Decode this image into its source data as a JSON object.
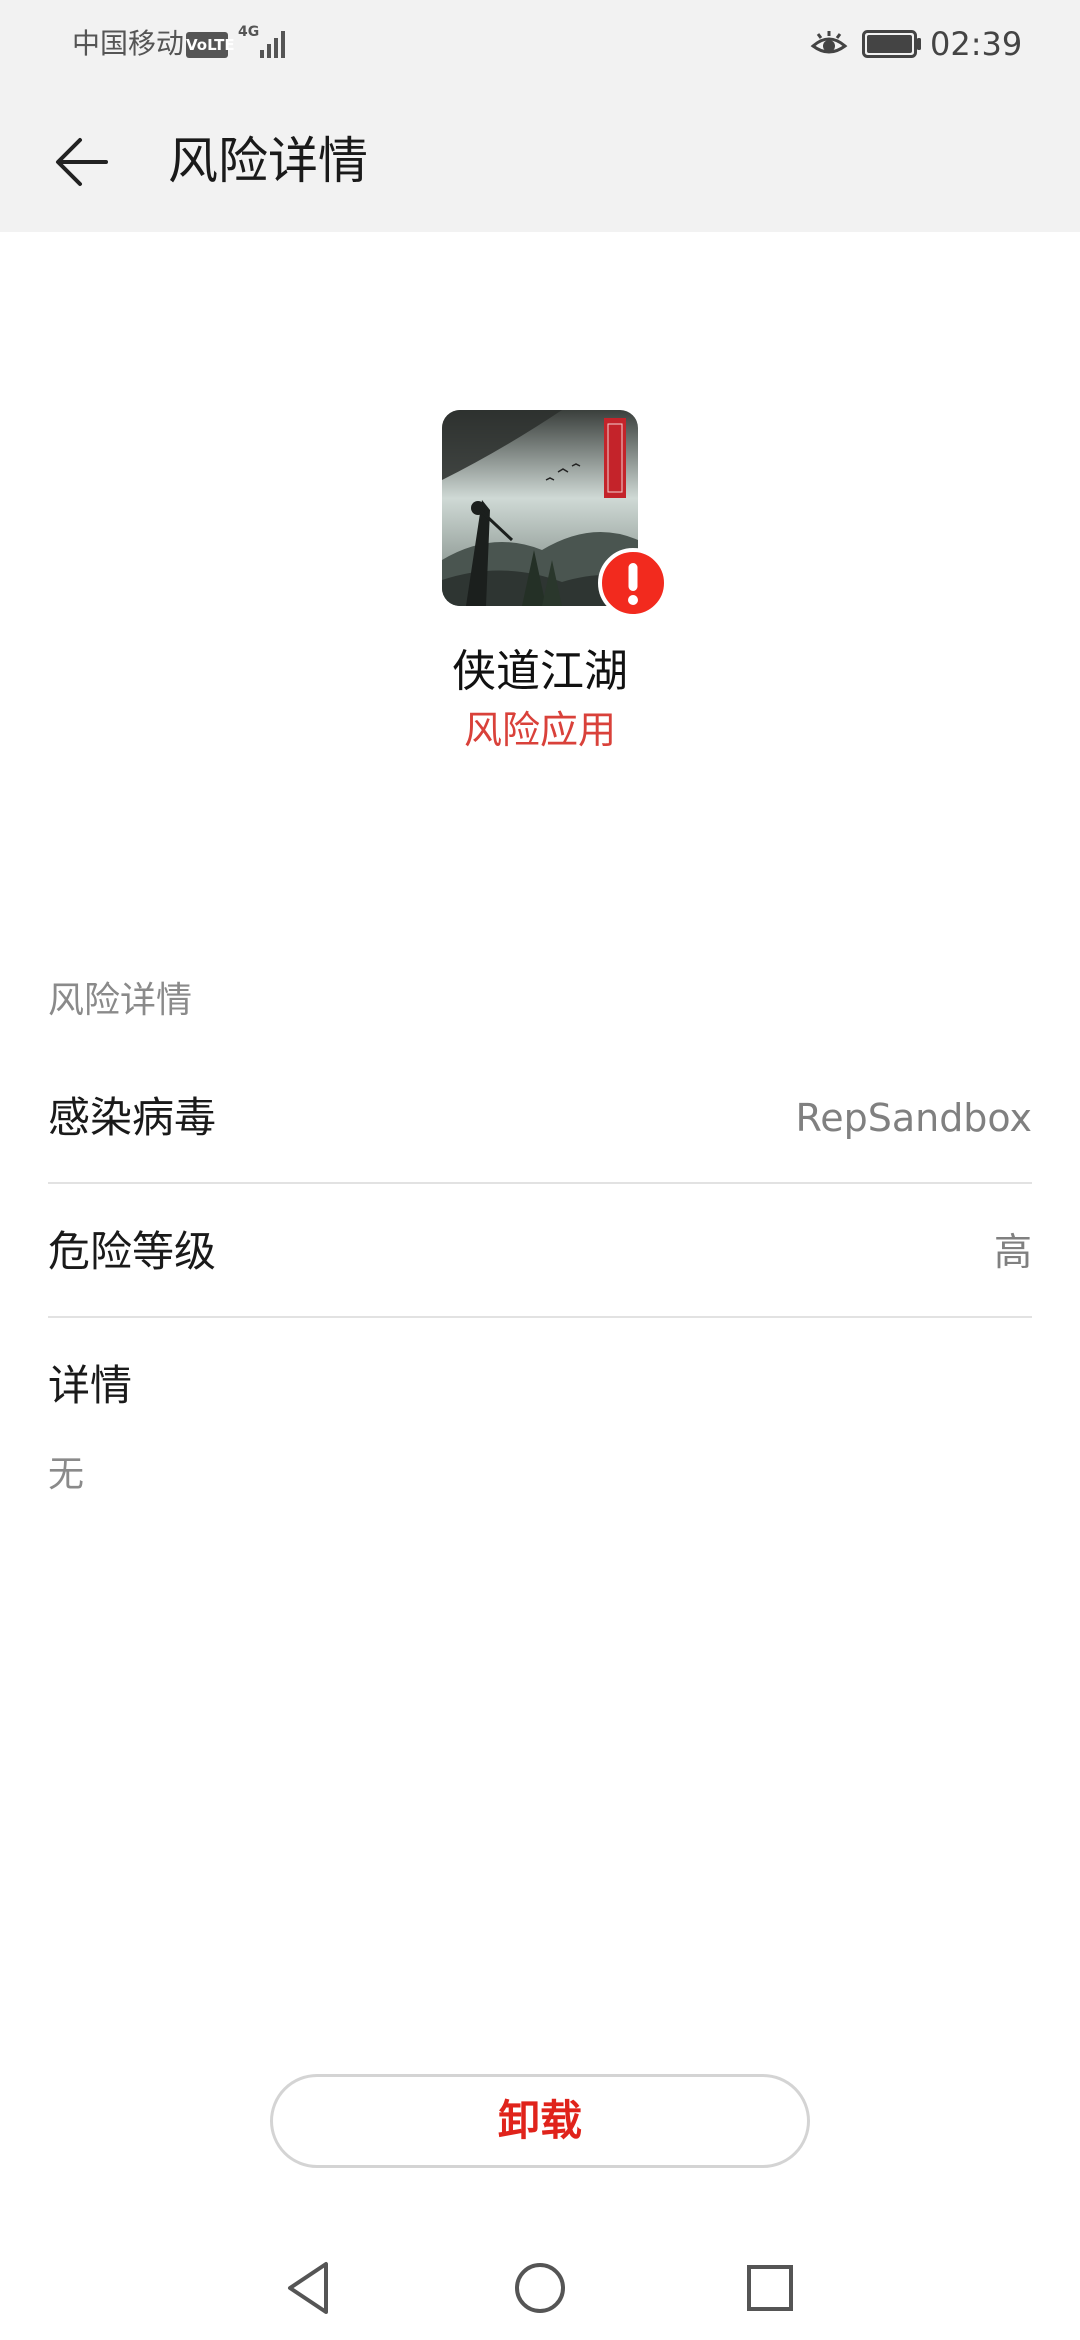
{
  "status_bar": {
    "carrier": "中国移动",
    "volte": "VoLTE",
    "network": "4G",
    "time": "02:39",
    "icons": [
      "signal-icon",
      "eye-icon",
      "battery-icon"
    ]
  },
  "title_bar": {
    "back_icon": "arrow-left-icon",
    "title": "风险详情"
  },
  "app": {
    "name": "侠道江湖",
    "status": "风险应用",
    "badge_icon": "exclamation-icon"
  },
  "details": {
    "section_title": "风险详情",
    "rows": [
      {
        "label": "感染病毒",
        "value": "RepSandbox"
      },
      {
        "label": "危险等级",
        "value": "高"
      }
    ],
    "info_label": "详情",
    "info_value": "无"
  },
  "uninstall_label": "卸载",
  "nav_bar": {
    "icons": [
      "back-triangle-icon",
      "home-circle-icon",
      "recents-square-icon"
    ]
  },
  "colors": {
    "risk_red": "#d9413a",
    "button_red": "#e0231b",
    "badge_red": "#f22a1e",
    "header_bg": "#f2f2f2"
  }
}
